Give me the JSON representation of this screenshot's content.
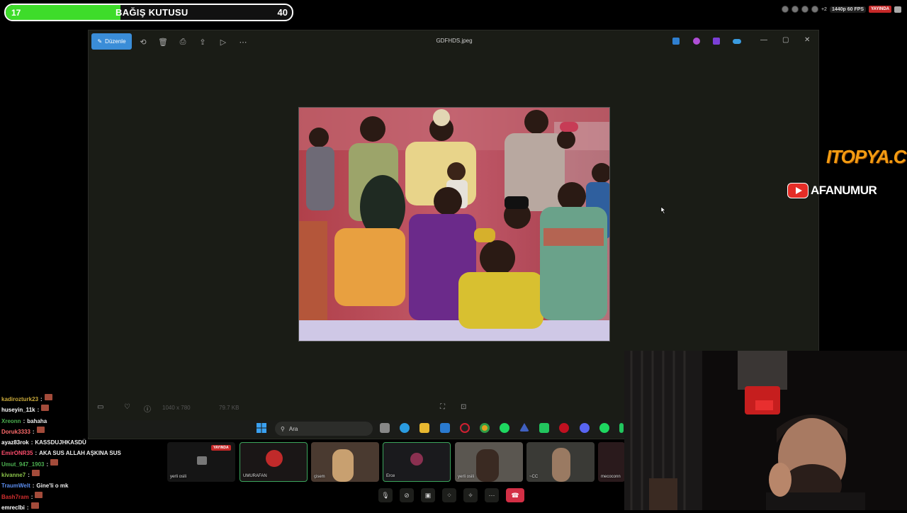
{
  "donation": {
    "start": "17",
    "title": "BAĞIŞ KUTUSU",
    "end": "40",
    "fill_percent": 40,
    "bar_color": "#3edc2a"
  },
  "stream": {
    "quality": "1440p 60 FPS",
    "live": "YAYINDA",
    "viewer_extra": "+2"
  },
  "viewer": {
    "edit_label": "Düzenle",
    "file_name": "GDFHDS.jpeg",
    "dimensions": "1040 x 780",
    "file_size": "79.7 KB",
    "accent": "#3a8dd8",
    "toolbar_icons": [
      "rotate-icon",
      "delete-icon",
      "print-icon",
      "share-icon",
      "slideshow-icon",
      "more-icon"
    ],
    "window_controls": [
      "minimize-icon",
      "maximize-icon",
      "close-icon"
    ]
  },
  "taskbar": {
    "search_placeholder": "Ara"
  },
  "chat": [
    {
      "user": "kadirozturk23",
      "sep": ":",
      "msg": "",
      "color": "#c9a93a",
      "emote": true
    },
    {
      "user": "huseyin_11k",
      "sep": ":",
      "msg": "",
      "color": "#ffffff",
      "emote": true
    },
    {
      "user": "Xreonn",
      "sep": ":",
      "msg": "bahaha",
      "color": "#4caf50",
      "emote": false
    },
    {
      "user": "Doruk3333",
      "sep": ":",
      "msg": "",
      "color": "#ff6b6b",
      "emote": true
    },
    {
      "user": "ayaz83rok",
      "sep": ":",
      "msg": "KASSDUJHKASDÜ",
      "color": "#ffffff",
      "emote": false
    },
    {
      "user": "EmirONR35",
      "sep": ":",
      "msg": "AKA SUS ALLAH AŞKINA SUS",
      "color": "#ff4d6d",
      "emote": false
    },
    {
      "user": "Umut_947_1903",
      "sep": ":",
      "msg": "",
      "color": "#4caf50",
      "emote": true
    },
    {
      "user": "kivanne7",
      "sep": ":",
      "msg": "",
      "color": "#8bc34a",
      "emote": true
    },
    {
      "user": "TraumWelt",
      "sep": ":",
      "msg": "Gine'li o mk",
      "color": "#5b8def",
      "emote": false
    },
    {
      "user": "Bash7ram",
      "sep": ":",
      "msg": "",
      "color": "#d32f2f",
      "emote": true
    },
    {
      "user": "emreclbi",
      "sep": ":",
      "msg": "",
      "color": "#ffffff",
      "emote": true
    }
  ],
  "call": {
    "live_badge": "YAYINDA",
    "tiles": [
      {
        "name": "yerli osili"
      },
      {
        "name": "UMURAFAN"
      },
      {
        "name": "çisem"
      },
      {
        "name": "Erce"
      },
      {
        "name": "yerli osili"
      },
      {
        "name": "~CC"
      },
      {
        "name": "mecoconn"
      }
    ]
  },
  "overlay": {
    "sponsor": "ITOPYA.C",
    "channel": "AFANUMUR"
  }
}
